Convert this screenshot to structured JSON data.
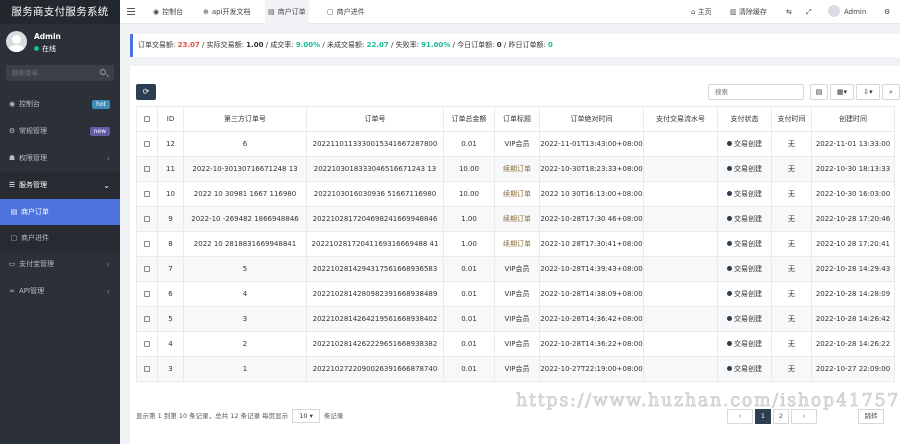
{
  "sidebar": {
    "brand": "服务商支付服务系统",
    "user": {
      "name": "Admin",
      "status": "在线"
    },
    "search_placeholder": "搜索菜单",
    "items": [
      {
        "label": "控制台",
        "icon": "dashboard-icon",
        "badge": "hot",
        "badge_color": "#3c8dbc"
      },
      {
        "label": "常规管理",
        "icon": "cog-icon",
        "badge": "new",
        "badge_color": "#605ca8"
      },
      {
        "label": "权限管理",
        "icon": "group-icon"
      },
      {
        "label": "服务管理",
        "icon": "list-icon"
      },
      {
        "label": "商户订单",
        "icon": "table-icon"
      },
      {
        "label": "商户进件",
        "icon": "file-icon"
      },
      {
        "label": "支付宝管理",
        "icon": "card-icon"
      },
      {
        "label": "API管理",
        "icon": "link-icon"
      }
    ]
  },
  "topbar": {
    "tabs": [
      {
        "label": "控制台",
        "icon": "dashboard-icon"
      },
      {
        "label": "api开发文档",
        "icon": "globe-icon"
      },
      {
        "label": "商户订单",
        "icon": "list-icon"
      },
      {
        "label": "商户进件",
        "icon": "file-icon"
      }
    ],
    "home": "主页",
    "clear_cache": "清除缓存",
    "admin": "Admin"
  },
  "stats": {
    "total_label": "订单交易额:",
    "total": "23.07",
    "actual_label": "/ 实际交易额:",
    "actual": "1.00",
    "success_label": "/ 成交率:",
    "success": "9.00%",
    "pending_label": "/ 未成交易额:",
    "pending": "22.07",
    "fail_label": "/ 失败率:",
    "fail": "91.00%",
    "today_label": "/ 今日订单额:",
    "today": "0",
    "yesterday_label": "/ 昨日订单额:",
    "yesterday": "0"
  },
  "toolbar": {
    "search_placeholder": "搜索"
  },
  "table": {
    "headers": [
      "ID",
      "第三方订单号",
      "订单号",
      "订单总金额",
      "订单标题",
      "订单绝对时间",
      "支付交易流水号",
      "支付状态",
      "支付时间",
      "创建时间"
    ],
    "rows": [
      [
        "12",
        "6",
        "2022110113330015341667287800",
        "0.01",
        "VIP会员",
        "2022-11-01T13:43:00+08:00",
        "",
        "交易创建",
        "无",
        "2022-11-01 13:33:00"
      ],
      [
        "11",
        "2022-10-30130716671248 13",
        "2022103018333046516671243 13",
        "10.00",
        "续期订单",
        "2022-10-30T18:23:33+08:00",
        "",
        "交易创建",
        "无",
        "2022-10-30 18:13:33"
      ],
      [
        "10",
        "2022 10 30981 1667 116980",
        "2022103016030936 51667116980",
        "10.00",
        "续期订单",
        "2022 10 30T16:13:00+08:00",
        "",
        "交易创建",
        "无",
        "2022-10-30 16:03:00"
      ],
      [
        "9",
        "2022-10 -269482 1866948846",
        "2022102817204698241669948846",
        "1.00",
        "续期订单",
        "2022-10-28T17:30 46+08:00",
        "",
        "交易创建",
        "无",
        "2022-10-28 17:20:46"
      ],
      [
        "8",
        "2022 10 2818831669948841",
        "20221028172041169316669488 41",
        "1.00",
        "续期订单",
        "2022-10 28T17:30:41+08:00",
        "",
        "交易创建",
        "无",
        "2022-10 28 17:20:41"
      ],
      [
        "7",
        "5",
        "2022102814294317561668936583",
        "0.01",
        "VIP会员",
        "2022-10-28T14:39:43+08:00",
        "",
        "交易创建",
        "无",
        "2022-10-28 14:29:43"
      ],
      [
        "6",
        "4",
        "2022102814280982391668938489",
        "0.01",
        "VIP会员",
        "2022-10-28T14:38:09+08:00",
        "",
        "交易创建",
        "无",
        "2022-10-28 14:28:09"
      ],
      [
        "5",
        "3",
        "2022102814264219561668938402",
        "0.01",
        "VIP会员",
        "2022-10-28T14:36:42+08:00",
        "",
        "交易创建",
        "无",
        "2022-10-28 14:26:42"
      ],
      [
        "4",
        "2",
        "2022102814262229651668938382",
        "0.01",
        "VIP会员",
        "2022-10-28T14:36:22+08:00",
        "",
        "交易创建",
        "无",
        "2022-10-28 14:26:22"
      ],
      [
        "3",
        "1",
        "2022102722090026391666878740",
        "0.01",
        "VIP会员",
        "2022-10-27T22:19:00+08:00",
        "",
        "交易创建",
        "无",
        "2022-10-27 22:09:00"
      ]
    ]
  },
  "footer": {
    "summary": "显示第 1 到第 10 条记录，总共 12 条记录 每页显示",
    "page_size": "10",
    "suffix": "条记录",
    "next": "跳转"
  },
  "watermark": "https://www.huzhan.com/ishop41757"
}
